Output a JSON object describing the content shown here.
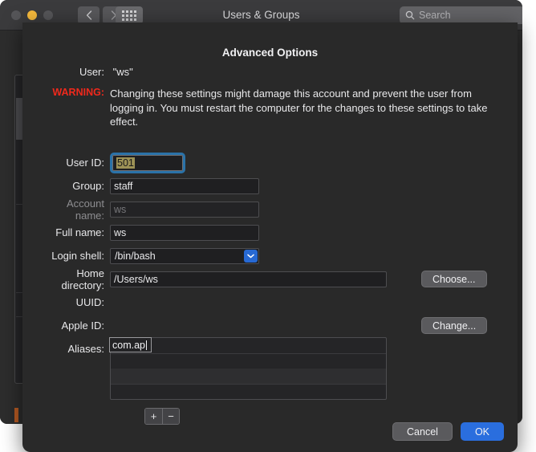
{
  "window": {
    "title": "Users & Groups",
    "traffic_lights": [
      "close-button",
      "minimize-button",
      "zoom-button"
    ],
    "nav": {
      "back": "back-icon",
      "forward": "forward-icon",
      "grid": "all-preferences-icon"
    },
    "search": {
      "placeholder": "Search",
      "icon": "search-icon",
      "value": ""
    }
  },
  "sheet": {
    "title": "Advanced Options",
    "user": {
      "label": "User:",
      "value": "\"ws\""
    },
    "warning": {
      "tag": "WARNING:",
      "text": "Changing these settings might damage this account and prevent the user from logging in. You must restart the computer for the changes to these settings to take effect."
    },
    "fields": {
      "user_id": {
        "label": "User ID:",
        "value": "501",
        "focused": true
      },
      "group": {
        "label": "Group:",
        "value": "staff"
      },
      "account_name": {
        "label": "Account name:",
        "value": "ws",
        "disabled": true
      },
      "full_name": {
        "label": "Full name:",
        "value": "ws"
      },
      "login_shell": {
        "label": "Login shell:",
        "value": "/bin/bash"
      },
      "home_directory": {
        "label": "Home directory:",
        "value": "/Users/ws"
      },
      "uuid": {
        "label": "UUID:",
        "value": ""
      },
      "apple_id": {
        "label": "Apple ID:",
        "value": ""
      },
      "aliases": {
        "label": "Aliases:",
        "value": "com.ap"
      }
    },
    "buttons": {
      "choose": "Choose...",
      "change": "Change...",
      "add": "+",
      "remove": "−",
      "cancel": "Cancel",
      "ok": "OK"
    },
    "colors": {
      "accent_blue": "#2a6ede",
      "focus_ring": "#2a72a8",
      "warning_red": "#f0291c",
      "selection": "#9d9256",
      "sheet_bg": "#292929"
    }
  }
}
